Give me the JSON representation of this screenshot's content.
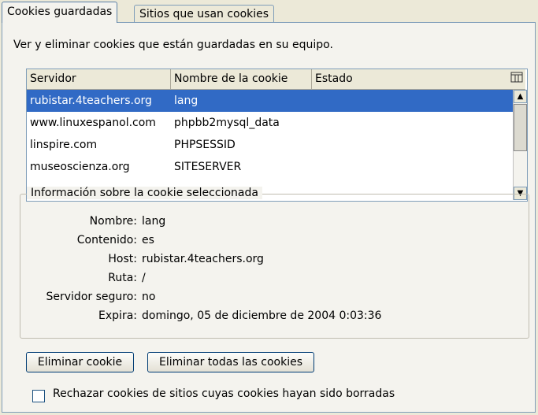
{
  "tabs": [
    "Cookies guardadas",
    "Sitios que usan cookies"
  ],
  "description": "Ver y eliminar cookies que están guardadas en su equipo.",
  "columns": [
    "Servidor",
    "Nombre de la cookie",
    "Estado"
  ],
  "rows": [
    {
      "server": "rubistar.4teachers.org",
      "name": "lang",
      "state": "",
      "selected": true
    },
    {
      "server": "www.linuxespanol.com",
      "name": "phpbb2mysql_data",
      "state": "",
      "selected": false
    },
    {
      "server": "linspire.com",
      "name": "PHPSESSID",
      "state": "",
      "selected": false
    },
    {
      "server": "museoscienza.org",
      "name": "SITESERVER",
      "state": "",
      "selected": false
    }
  ],
  "info": {
    "legend": "Información sobre la cookie seleccionada",
    "fields": [
      {
        "label": "Nombre:",
        "value": "lang"
      },
      {
        "label": "Contenido:",
        "value": "es"
      },
      {
        "label": "Host:",
        "value": "rubistar.4teachers.org"
      },
      {
        "label": "Ruta:",
        "value": "/"
      },
      {
        "label": "Servidor seguro:",
        "value": "no"
      },
      {
        "label": "Expira:",
        "value": "domingo, 05 de diciembre de 2004 0:03:36"
      }
    ]
  },
  "buttons": {
    "remove": "Eliminar cookie",
    "remove_all": "Eliminar todas las cookies"
  },
  "checkbox": {
    "label": "Rechazar cookies de sitios cuyas cookies hayan sido borradas",
    "checked": false
  }
}
